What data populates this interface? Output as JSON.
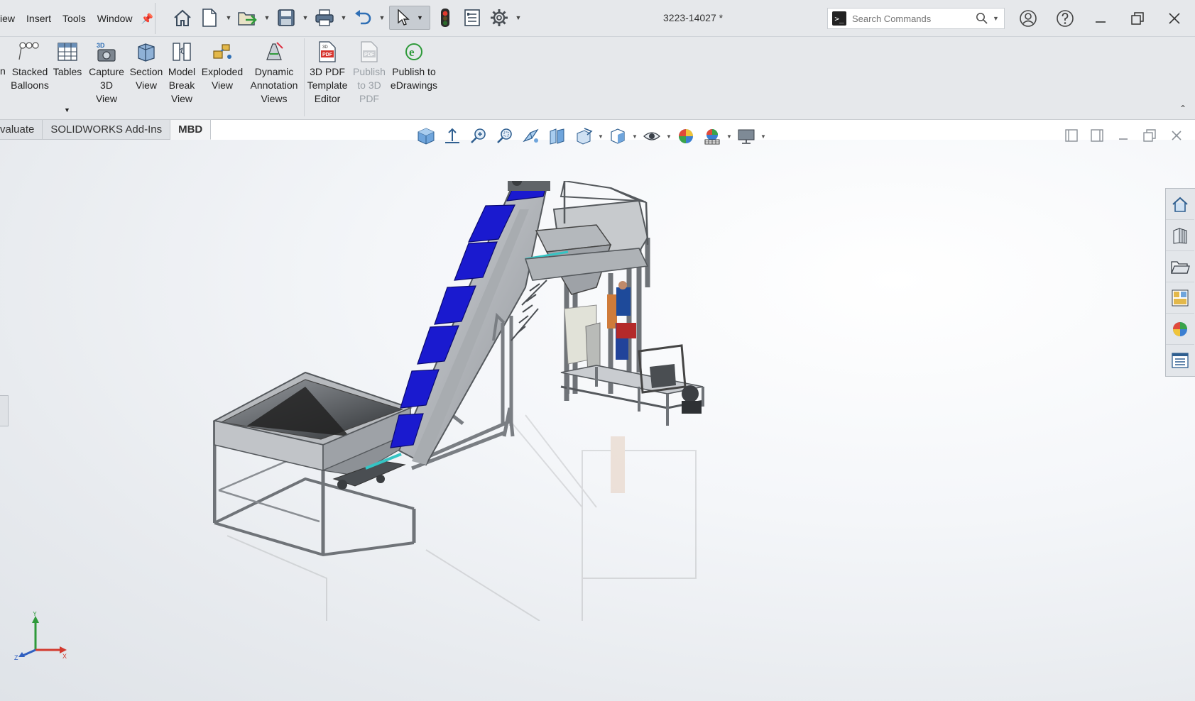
{
  "menu": {
    "items": [
      "iew",
      "Insert",
      "Tools",
      "Window"
    ]
  },
  "document": {
    "title": "3223-14027 *"
  },
  "search": {
    "placeholder": "Search Commands"
  },
  "ribbon": {
    "buttons": [
      {
        "label": "Stacked\nBalloons",
        "icon": "stacked-balloons-icon"
      },
      {
        "label": "Tables",
        "icon": "table-icon"
      },
      {
        "label": "Capture\n3D\nView",
        "icon": "capture-3d-view-icon"
      },
      {
        "label": "Section\nView",
        "icon": "section-view-icon"
      },
      {
        "label": "Model\nBreak\nView",
        "icon": "model-break-view-icon"
      },
      {
        "label": "Exploded\nView",
        "icon": "exploded-view-icon"
      },
      {
        "label": "Dynamic\nAnnotation\nViews",
        "icon": "dynamic-annotation-icon"
      },
      {
        "label": "3D PDF\nTemplate\nEditor",
        "icon": "3d-pdf-template-icon"
      },
      {
        "label": "Publish\nto 3D\nPDF",
        "icon": "publish-3d-pdf-icon",
        "disabled": true
      },
      {
        "label": "Publish to\neDrawings",
        "icon": "edrawings-icon"
      }
    ],
    "left_fragment": "n"
  },
  "tabs": [
    {
      "label": "valuate"
    },
    {
      "label": "SOLIDWORKS Add-Ins"
    },
    {
      "label": "MBD",
      "active": true
    }
  ],
  "triad": {
    "x": "X",
    "y": "Y",
    "z": "Z"
  },
  "colors": {
    "chrome": "#e6e8eb",
    "accent_blue": "#1a1acf",
    "frame_gray": "#8c8f94"
  }
}
